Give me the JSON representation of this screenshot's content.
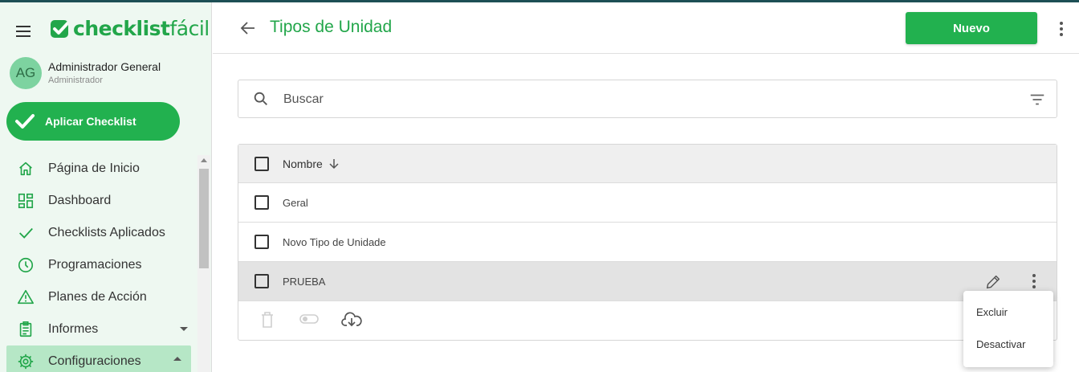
{
  "app": {
    "logo_bold": "checklist",
    "logo_light": "fácil",
    "brand_color": "#22b14f"
  },
  "user": {
    "initials": "AG",
    "name": "Administrador General",
    "role": "Administrador"
  },
  "apply_button": {
    "label": "Aplicar Checklist"
  },
  "sidebar": {
    "items": [
      {
        "label": "Página de Inicio",
        "icon": "home-icon"
      },
      {
        "label": "Dashboard",
        "icon": "dashboard-icon"
      },
      {
        "label": "Checklists Aplicados",
        "icon": "check-icon"
      },
      {
        "label": "Programaciones",
        "icon": "clock-icon"
      },
      {
        "label": "Planes de Acción",
        "icon": "warning-icon"
      },
      {
        "label": "Informes",
        "icon": "clipboard-icon",
        "expandable": true,
        "expanded": false
      },
      {
        "label": "Configuraciones",
        "icon": "gear-icon",
        "expandable": true,
        "expanded": true,
        "active": true
      }
    ]
  },
  "header": {
    "title": "Tipos de Unidad",
    "new_button": "Nuevo"
  },
  "search": {
    "placeholder": "Buscar",
    "value": ""
  },
  "table": {
    "column_header": "Nombre",
    "sort": "descending",
    "rows": [
      {
        "name": "Geral",
        "selected": false
      },
      {
        "name": "Novo Tipo de Unidade",
        "selected": false
      },
      {
        "name": "PRUEBA",
        "selected": false,
        "highlighted": true
      }
    ]
  },
  "context_menu": {
    "items": [
      "Excluir",
      "Desactivar"
    ]
  }
}
